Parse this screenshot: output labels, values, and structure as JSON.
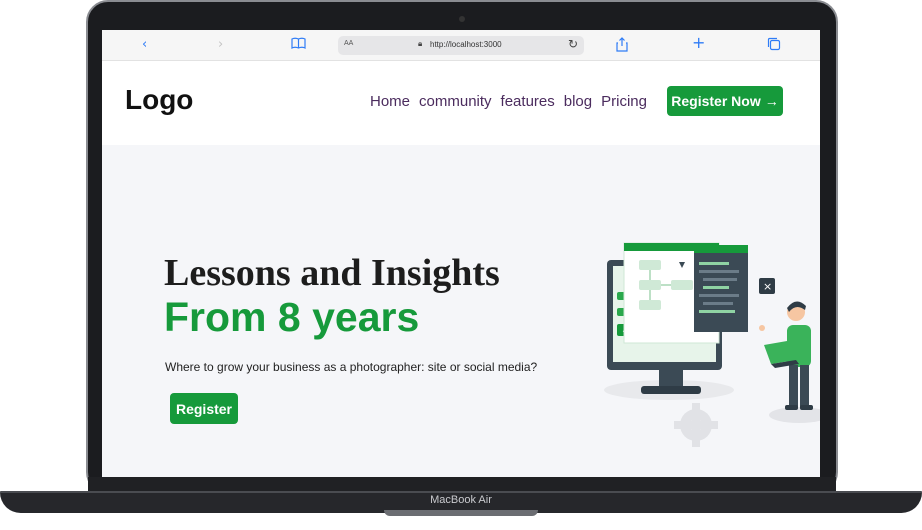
{
  "device": {
    "model_label": "MacBook Air"
  },
  "browser": {
    "address_bar": {
      "text_size_label": "AA",
      "url": "http://localhost:3000"
    },
    "icons": [
      "back-icon",
      "forward-icon",
      "bookmarks-icon",
      "lock-icon",
      "reload-icon",
      "share-icon",
      "new-tab-icon",
      "tabs-icon"
    ]
  },
  "navbar": {
    "logo": "Logo",
    "links": [
      "Home",
      "community",
      "features",
      "blog",
      "Pricing"
    ],
    "cta_label": "Register Now",
    "cta_icon": "arrow-right-icon"
  },
  "hero": {
    "title": "Lessons and Insights",
    "subtitle": "From 8 years",
    "description": "Where to grow your business as a photographer: site or social media?",
    "button_label": "Register"
  },
  "colors": {
    "accent": "#169a3b",
    "nav_text": "#4b2c5e",
    "page_background": "#f5f6f9",
    "heading": "#1d1d1d"
  }
}
